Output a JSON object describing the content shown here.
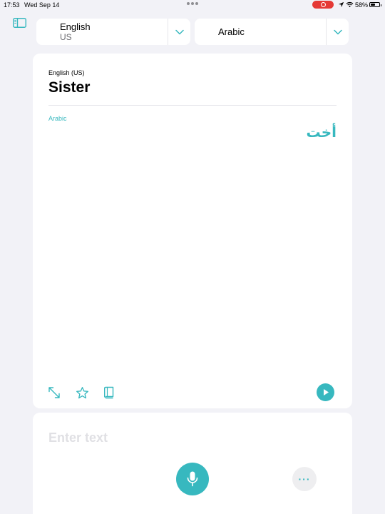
{
  "status_bar": {
    "time": "17:53",
    "date": "Wed Sep 14",
    "battery_percent": "58%",
    "battery_level": 0.58,
    "icons": [
      "multitasking-dots-icon",
      "screen-recording-icon",
      "location-arrow-icon",
      "wifi-icon",
      "battery-icon"
    ]
  },
  "toolbar": {
    "sidebar_icon": "sidebar-icon"
  },
  "language_picker": {
    "source": {
      "name": "English",
      "region": "US",
      "icon": "chevron-down-icon"
    },
    "target": {
      "name": "Arabic",
      "icon": "chevron-down-icon"
    }
  },
  "translation": {
    "source_label": "English (US)",
    "source_text": "Sister",
    "target_label": "Arabic",
    "target_text": "أخت",
    "actions": [
      "expand-icon",
      "star-icon",
      "dictionary-icon",
      "play-icon"
    ]
  },
  "input": {
    "placeholder": "Enter text",
    "value": "",
    "more_label": "···",
    "icons": [
      "microphone-icon",
      "more-icon"
    ]
  },
  "colors": {
    "accent": "#37b8bf",
    "background": "#f2f2f7",
    "card": "#ffffff",
    "recording": "#e53935"
  }
}
